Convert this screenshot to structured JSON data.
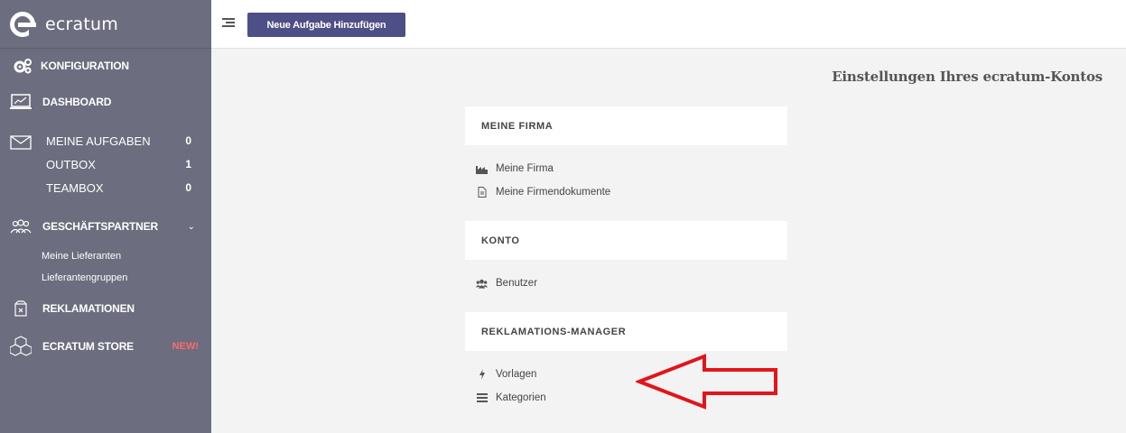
{
  "brand": {
    "name": "ecratum"
  },
  "sidebar": {
    "konfiguration": "KONFIGURATION",
    "dashboard": "DASHBOARD",
    "inbox": [
      {
        "label": "MEINE AUFGABEN",
        "count": "0"
      },
      {
        "label": "OUTBOX",
        "count": "1"
      },
      {
        "label": "TEAMBOX",
        "count": "0"
      }
    ],
    "partner": "GESCHÄFTSPARTNER",
    "partner_links": [
      "Meine Lieferanten",
      "Lieferantengruppen"
    ],
    "reklamationen": "REKLAMATIONEN",
    "store": "ECRATUM STORE",
    "store_badge": "NEW!"
  },
  "toolbar": {
    "new_task": "Neue Aufgabe Hinzufügen"
  },
  "page": {
    "title": "Einstellungen Ihres ecratum-Kontos",
    "sections": [
      {
        "heading": "MEINE FIRMA",
        "links": [
          "Meine Firma",
          "Meine Firmendokumente"
        ]
      },
      {
        "heading": "KONTO",
        "links": [
          "Benutzer"
        ]
      },
      {
        "heading": "REKLAMATIONS-MANAGER",
        "links": [
          "Vorlagen",
          "Kategorien"
        ]
      }
    ]
  },
  "colors": {
    "sidebar": "#6c6d7e",
    "primary_button": "#4e4f86",
    "badge_new": "#ff6b6b",
    "annotation_arrow": "#e3151a"
  },
  "icons": [
    "gears-icon",
    "dashboard-icon",
    "envelope-icon",
    "partners-icon",
    "complaint-box-icon",
    "store-icon",
    "menu-toggle-icon",
    "factory-icon",
    "document-icon",
    "users-icon",
    "bolt-icon",
    "list-icon",
    "red-arrow-annotation"
  ]
}
